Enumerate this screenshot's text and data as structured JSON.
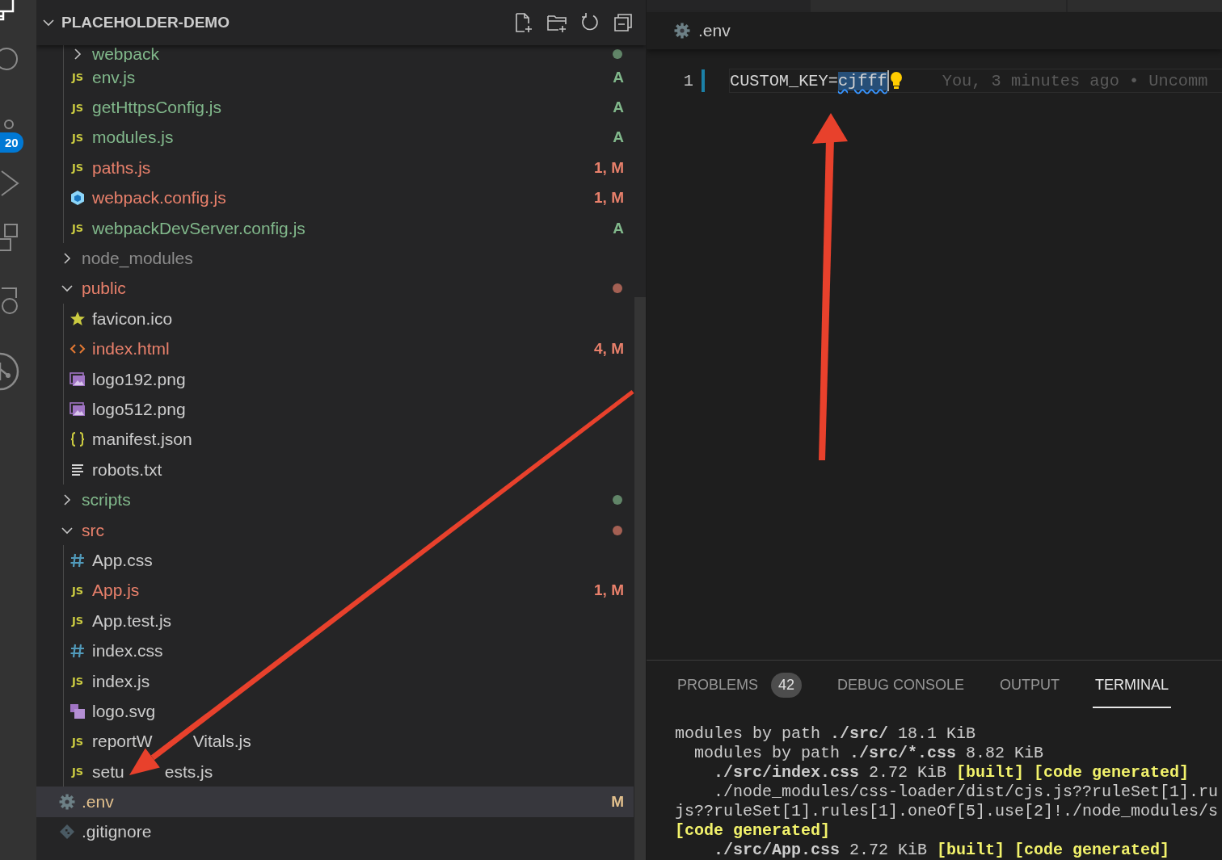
{
  "activity_bar": {
    "badge": "20"
  },
  "explorer": {
    "title": "PLACEHOLDER-DEMO",
    "expanded": true,
    "continued_items": [
      {
        "name": "webpack",
        "kind": "folder",
        "expanded": false,
        "color": "#81b88b",
        "has_dot": true,
        "selected": false
      },
      {
        "name": "env.js",
        "kind": "js",
        "icon_text": "JS",
        "color": "#81b88b",
        "badge": "A",
        "selected": false
      },
      {
        "name": "getHttpsConfig.js",
        "kind": "js",
        "icon_text": "JS",
        "color": "#81b88b",
        "badge": "A",
        "selected": false
      },
      {
        "name": "modules.js",
        "kind": "js",
        "icon_text": "JS",
        "color": "#81b88b",
        "badge": "A",
        "selected": false
      },
      {
        "name": "paths.js",
        "kind": "js",
        "icon_text": "JS",
        "color": "#e8806b",
        "badge": "1, M",
        "selected": false
      },
      {
        "name": "webpack.config.js",
        "kind": "webpack",
        "color": "#e8806b",
        "badge": "1, M",
        "selected": false
      },
      {
        "name": "webpackDevServer.config.js",
        "kind": "js",
        "icon_text": "JS",
        "color": "#81b88b",
        "badge": "A",
        "selected": false
      }
    ],
    "items": [
      {
        "name": "node_modules",
        "kind": "folder",
        "expanded": false,
        "color": "#8c8c8c",
        "has_dot": false,
        "selected": false
      },
      {
        "name": "public",
        "kind": "folder",
        "expanded": true,
        "color": "#e8806b",
        "has_dot": true,
        "selected": false,
        "children": [
          {
            "name": "favicon.ico",
            "kind": "star",
            "color": "#cccccc",
            "selected": false
          },
          {
            "name": "index.html",
            "kind": "html",
            "color": "#e8806b",
            "badge": "4, M",
            "selected": false
          },
          {
            "name": "logo192.png",
            "kind": "image",
            "color": "#cccccc",
            "selected": false
          },
          {
            "name": "logo512.png",
            "kind": "image",
            "color": "#cccccc",
            "selected": false
          },
          {
            "name": "manifest.json",
            "kind": "json",
            "color": "#cccccc",
            "selected": false
          },
          {
            "name": "robots.txt",
            "kind": "text",
            "color": "#cccccc",
            "selected": false
          }
        ]
      },
      {
        "name": "scripts",
        "kind": "folder",
        "expanded": false,
        "color": "#81b88b",
        "has_dot": true,
        "selected": false
      },
      {
        "name": "src",
        "kind": "folder",
        "expanded": true,
        "color": "#e8806b",
        "has_dot": true,
        "selected": false,
        "children": [
          {
            "name": "App.css",
            "kind": "css",
            "color": "#cccccc",
            "selected": false
          },
          {
            "name": "App.js",
            "kind": "js",
            "icon_text": "JS",
            "color": "#e8806b",
            "badge": "1, M",
            "selected": false
          },
          {
            "name": "App.test.js",
            "kind": "js",
            "icon_text": "JS",
            "color": "#cccccc",
            "selected": false
          },
          {
            "name": "index.css",
            "kind": "css",
            "color": "#cccccc",
            "selected": false
          },
          {
            "name": "index.js",
            "kind": "js",
            "icon_text": "JS",
            "color": "#cccccc",
            "selected": false
          },
          {
            "name": "logo.svg",
            "kind": "svg",
            "color": "#cccccc",
            "selected": false
          },
          {
            "name_parts": [
              "reportW",
              "Vitals.js"
            ],
            "kind": "js",
            "icon_text": "JS",
            "color": "#cccccc",
            "selected": false
          },
          {
            "name_parts": [
              "setu",
              "ests.js"
            ],
            "kind": "js",
            "icon_text": "JS",
            "color": "#cccccc",
            "selected": false
          }
        ]
      },
      {
        "name": ".env",
        "kind": "gear",
        "color": "#e2c08d",
        "badge": "M",
        "selected": true
      },
      {
        "name": ".gitignore",
        "kind": "git",
        "color": "#cccccc",
        "selected": false
      }
    ]
  },
  "editor": {
    "breadcrumb": ".env",
    "lines": [
      {
        "number": "1",
        "text": "CUSTOM_KEY=",
        "selected_text": "cjfff",
        "blame": "You, 3 minutes ago • Uncomm"
      }
    ]
  },
  "panel": {
    "tabs": [
      {
        "label": "PROBLEMS",
        "count": "42",
        "selected": false
      },
      {
        "label": "DEBUG CONSOLE",
        "selected": false
      },
      {
        "label": "OUTPUT",
        "selected": false
      },
      {
        "label": "TERMINAL",
        "selected": true
      }
    ],
    "terminal_lines": [
      [
        {
          "text": "modules by path ",
          "kind": "plain"
        },
        {
          "text": "./src/",
          "kind": "path"
        },
        {
          "text": " 18.1 KiB",
          "kind": "plain"
        }
      ],
      [
        {
          "text": "  modules by path ",
          "kind": "plain"
        },
        {
          "text": "./src/*.css",
          "kind": "path"
        },
        {
          "text": " 8.82 KiB",
          "kind": "plain"
        }
      ],
      [
        {
          "text": "    ./src/index.css",
          "kind": "path"
        },
        {
          "text": " 2.72 KiB ",
          "kind": "plain"
        },
        {
          "text": "[built] [code generated]",
          "kind": "flag"
        }
      ],
      [
        {
          "text": "    ./node_modules/css-loader/dist/cjs.js??ruleSet[1].ru",
          "kind": "plain"
        }
      ],
      [
        {
          "text": "js??ruleSet[1].rules[1].oneOf[5].use[2]!./node_modules/s",
          "kind": "plain"
        }
      ],
      [
        {
          "text": "[code generated]",
          "kind": "flag"
        }
      ],
      [
        {
          "text": "    ./src/App.css",
          "kind": "path"
        },
        {
          "text": " 2.72 KiB ",
          "kind": "plain"
        },
        {
          "text": "[built] [code generated]",
          "kind": "flag"
        }
      ]
    ]
  }
}
